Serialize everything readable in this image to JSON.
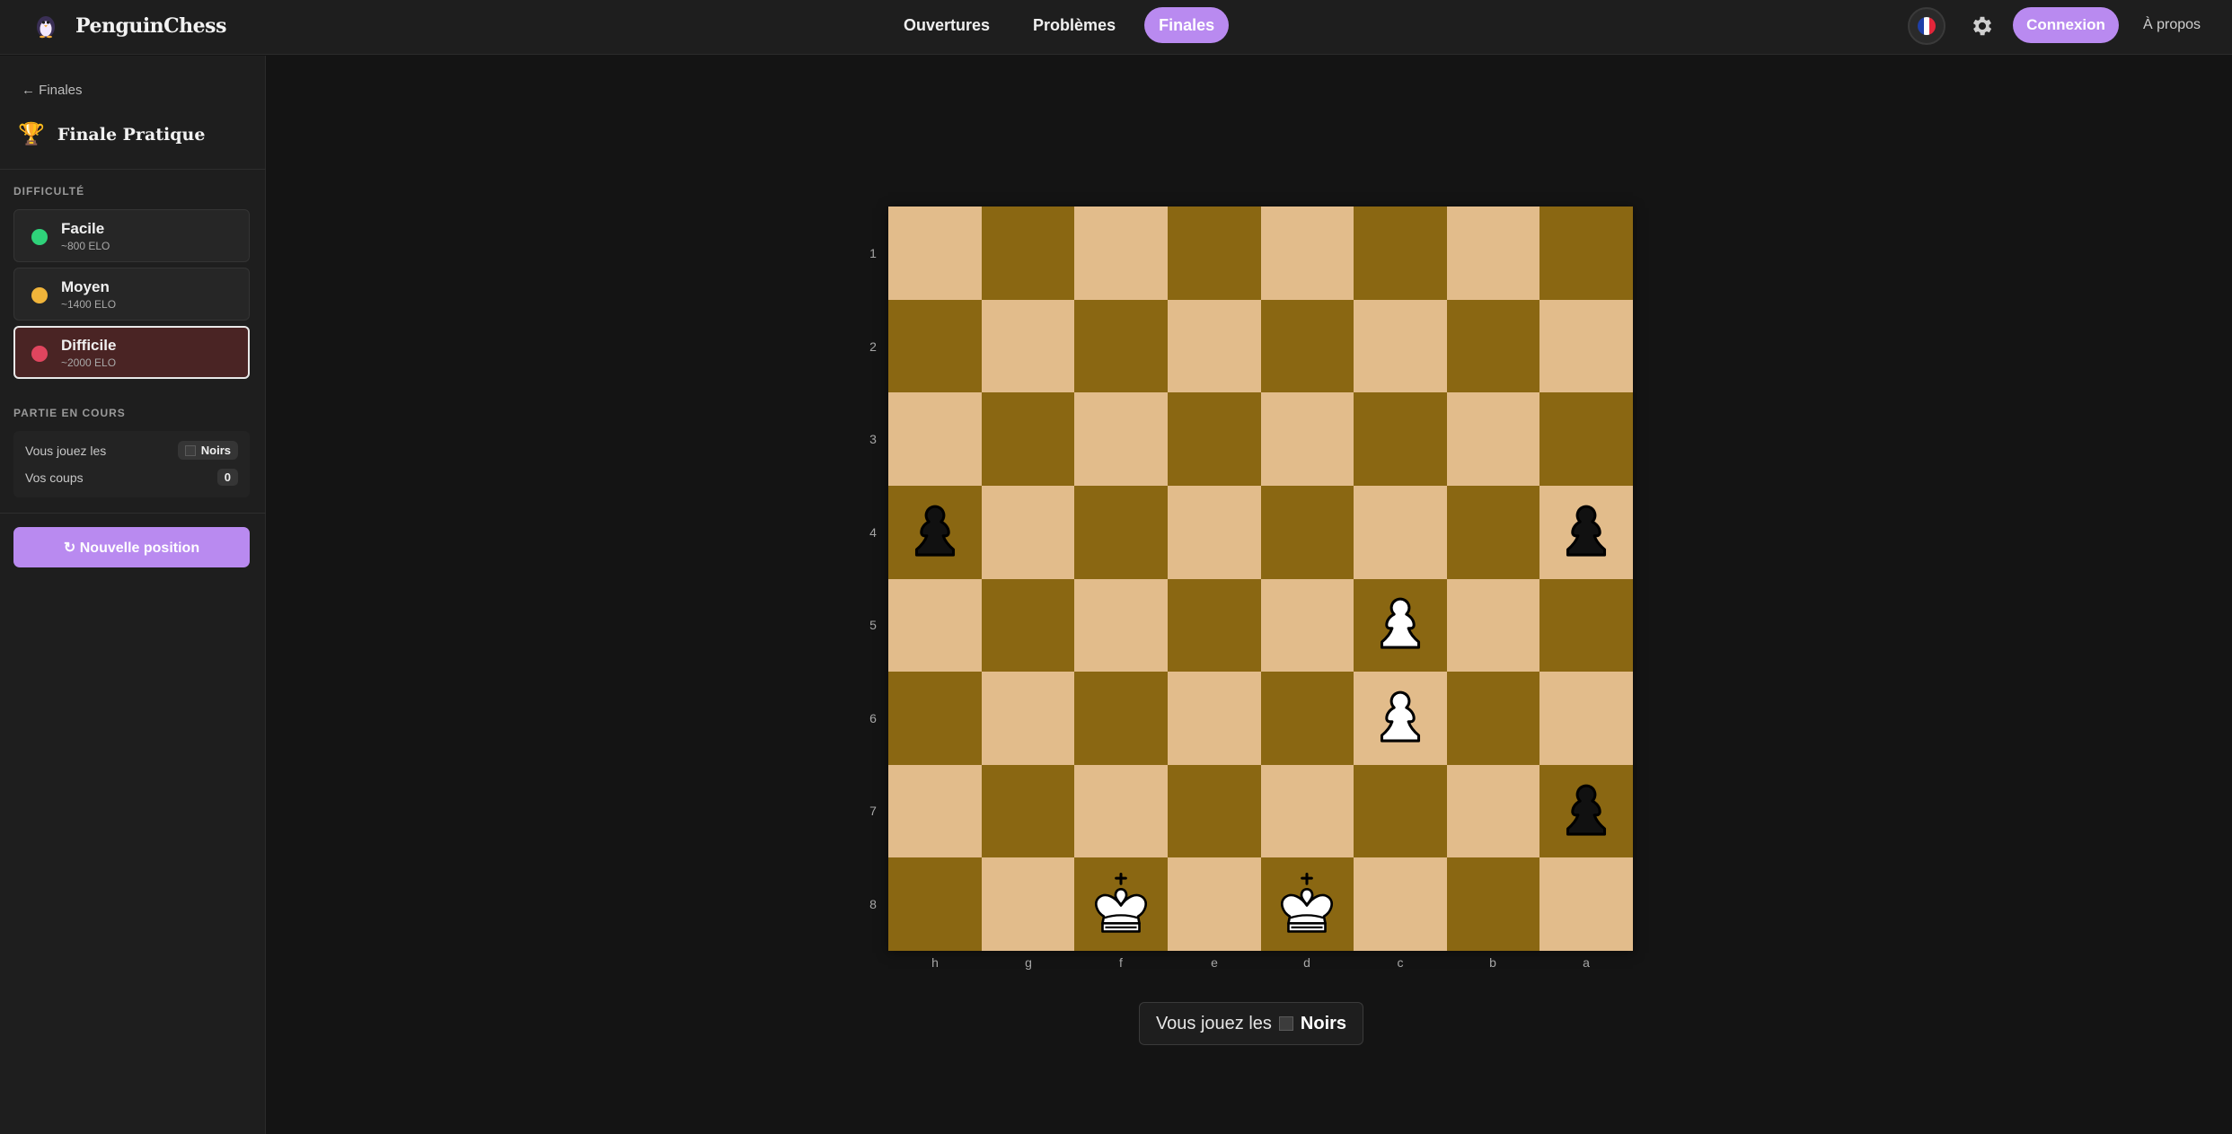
{
  "header": {
    "brand": "PenguinChess",
    "nav": [
      {
        "label": "Ouvertures",
        "active": false
      },
      {
        "label": "Problèmes",
        "active": false
      },
      {
        "label": "Finales",
        "active": true
      }
    ],
    "language_flag": "fr",
    "settings_icon": "gear-icon",
    "login_label": "Connexion",
    "about_label": "À propos",
    "accent_color": "#b98af0"
  },
  "sidebar": {
    "back_label": "← Finales",
    "title_icon": "🏆",
    "title": "Finale Pratique",
    "difficulty_label": "DIFFICULTÉ",
    "difficulties": [
      {
        "name": "Facile",
        "elo": "~800 ELO",
        "color": "#2fd27a",
        "selected": false
      },
      {
        "name": "Moyen",
        "elo": "~1400 ELO",
        "color": "#f0b43a",
        "selected": false
      },
      {
        "name": "Difficile",
        "elo": "~2000 ELO",
        "color": "#e0455e",
        "selected": true
      }
    ],
    "game_label": "PARTIE EN COURS",
    "you_play_label": "Vous jouez les",
    "you_play_value": "Noirs",
    "moves_label": "Vos coups",
    "moves_value": "0",
    "new_position_label": "↻ Nouvelle position"
  },
  "board": {
    "ranks": [
      "1",
      "2",
      "3",
      "4",
      "5",
      "6",
      "7",
      "8"
    ],
    "files": [
      "h",
      "g",
      "f",
      "e",
      "d",
      "c",
      "b",
      "a"
    ],
    "light_color": "#e2bc8b",
    "dark_color": "#8a6712",
    "pieces": [
      {
        "square": "h4",
        "piece": "pawn",
        "color": "black"
      },
      {
        "square": "a4",
        "piece": "pawn",
        "color": "black"
      },
      {
        "square": "c5",
        "piece": "pawn",
        "color": "white"
      },
      {
        "square": "c6",
        "piece": "pawn",
        "color": "white"
      },
      {
        "square": "a7",
        "piece": "pawn",
        "color": "black"
      },
      {
        "square": "f8",
        "piece": "king",
        "color": "white"
      },
      {
        "square": "d8",
        "piece": "king",
        "color": "white"
      }
    ]
  },
  "status": {
    "prefix": "Vous jouez les",
    "value": "Noirs"
  }
}
